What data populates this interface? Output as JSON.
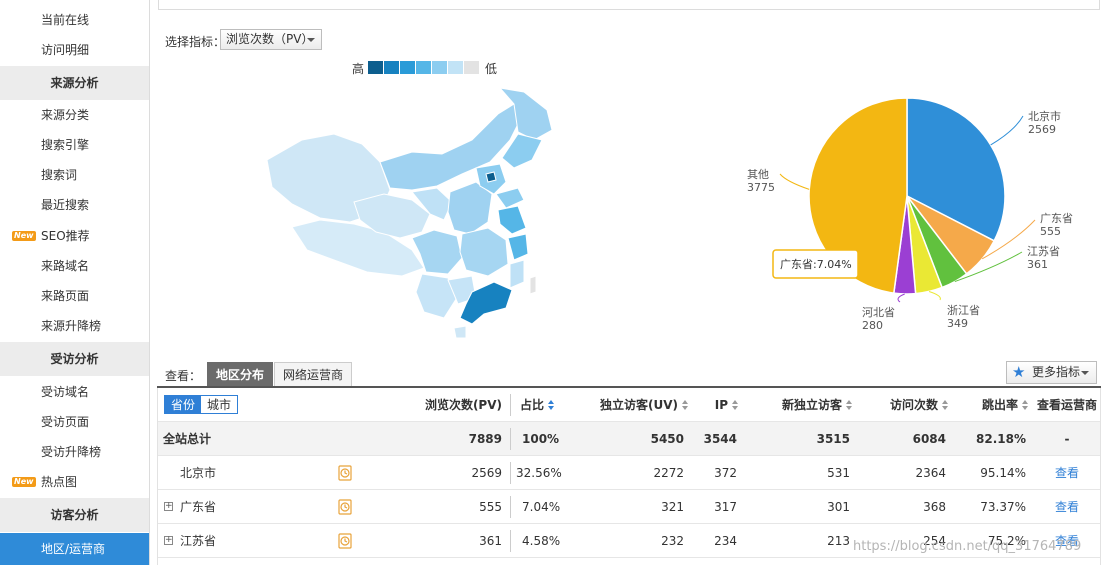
{
  "sidebar": {
    "items_top": [
      {
        "label": "当前在线"
      },
      {
        "label": "访问明细"
      }
    ],
    "section_source": "来源分析",
    "source_items": [
      {
        "label": "来源分类"
      },
      {
        "label": "搜索引擎"
      },
      {
        "label": "搜索词"
      },
      {
        "label": "最近搜索"
      },
      {
        "label": "SEO推荐",
        "badge": "New"
      },
      {
        "label": "来路域名"
      },
      {
        "label": "来路页面"
      },
      {
        "label": "来源升降榜"
      }
    ],
    "section_visited": "受访分析",
    "visited_items": [
      {
        "label": "受访域名"
      },
      {
        "label": "受访页面"
      },
      {
        "label": "受访升降榜"
      },
      {
        "label": "热点图",
        "badge": "New"
      }
    ],
    "section_visitor": "访客分析",
    "active_item": "地区/运营商"
  },
  "metric_selector": {
    "label": "选择指标：",
    "value": "浏览次数（PV）"
  },
  "map_legend": {
    "high": "高",
    "low": "低",
    "colors": [
      "#0d5e8e",
      "#1782c0",
      "#2a9bd8",
      "#55b6e7",
      "#8ccdf0",
      "#c2e3f6",
      "#e3e3e3"
    ]
  },
  "chart_data": {
    "type": "pie",
    "slices": [
      {
        "name": "北京市",
        "value": 2569,
        "color": "#2f8fd8"
      },
      {
        "name": "广东省",
        "value": 555,
        "color": "#f5a94a"
      },
      {
        "name": "江苏省",
        "value": 361,
        "color": "#61c13e"
      },
      {
        "name": "浙江省",
        "value": 349,
        "color": "#eae834"
      },
      {
        "name": "河北省",
        "value": 280,
        "color": "#9b3fd3"
      },
      {
        "name": "其他",
        "value": 3775,
        "color": "#f3b712"
      }
    ],
    "tooltip": "广东省:7.04%"
  },
  "tabs": {
    "view_label": "查看：",
    "items": [
      {
        "label": "地区分布",
        "active": true
      },
      {
        "label": "网络运营商",
        "active": false
      }
    ],
    "more_metrics": "更多指标"
  },
  "table": {
    "toggle": {
      "province": "省份",
      "city": "城市"
    },
    "headers": {
      "pv": "浏览次数(PV)",
      "ratio": "占比",
      "uv": "独立访客(UV)",
      "ip": "IP",
      "new_visitors": "新独立访客",
      "visits": "访问次数",
      "bounce": "跳出率",
      "isp": "查看运营商"
    },
    "total": {
      "label": "全站总计",
      "pv": "7889",
      "ratio": "100%",
      "uv": "5450",
      "ip": "3544",
      "new_visitors": "3515",
      "visits": "6084",
      "bounce": "82.18%",
      "isp": "-"
    },
    "rows": [
      {
        "name": "北京市",
        "pv": "2569",
        "ratio": "32.56%",
        "uv": "2272",
        "ip": "372",
        "new_visitors": "531",
        "visits": "2364",
        "bounce": "95.14%",
        "isp": "查看",
        "expandable": false
      },
      {
        "name": "广东省",
        "pv": "555",
        "ratio": "7.04%",
        "uv": "321",
        "ip": "317",
        "new_visitors": "301",
        "visits": "368",
        "bounce": "73.37%",
        "isp": "查看",
        "expandable": true
      },
      {
        "name": "江苏省",
        "pv": "361",
        "ratio": "4.58%",
        "uv": "232",
        "ip": "234",
        "new_visitors": "213",
        "visits": "254",
        "bounce": "75.2%",
        "isp": "查看",
        "expandable": true
      }
    ]
  },
  "watermark": "https://blog.csdn.net/qq_31764789"
}
